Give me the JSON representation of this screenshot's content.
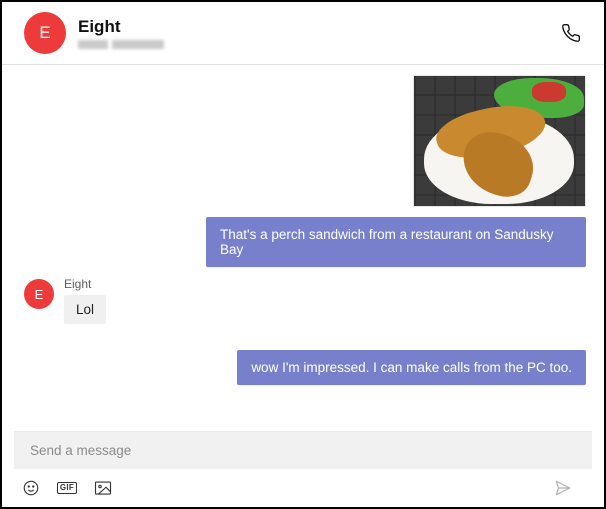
{
  "header": {
    "avatar_initial": "E",
    "contact_name": "Eight"
  },
  "messages": {
    "my_text_1": "That's a perch sandwich from a restaurant on Sandusky Bay",
    "other_avatar_initial": "E",
    "other_sender": "Eight",
    "other_text_1": "Lol",
    "my_text_2": "wow I'm impressed. I can make calls from the PC too."
  },
  "compose": {
    "placeholder": "Send a message"
  },
  "toolbar": {
    "gif_label": "GIF"
  }
}
